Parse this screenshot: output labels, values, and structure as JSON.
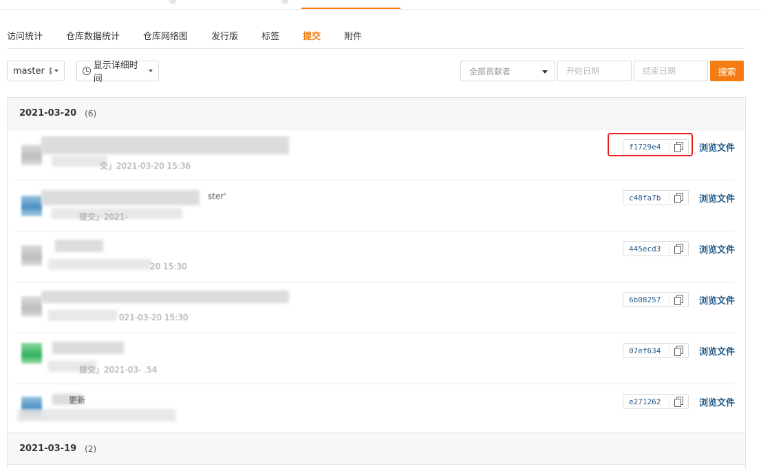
{
  "subnav": {
    "items": [
      {
        "label": "访问统计",
        "active": false
      },
      {
        "label": "仓库数据统计",
        "active": false
      },
      {
        "label": "仓库网络图",
        "active": false
      },
      {
        "label": "发行版",
        "active": false
      },
      {
        "label": "标签",
        "active": false
      },
      {
        "label": "提交",
        "active": true
      },
      {
        "label": "附件",
        "active": false
      }
    ]
  },
  "toolbar": {
    "branch_label": "master",
    "time_toggle_label": "显示详细时间",
    "author_select_label": "全部贡献者",
    "start_date_placeholder": "开始日期",
    "end_date_placeholder": "结束日期",
    "search_label": "搜索"
  },
  "groups": [
    {
      "date": "2021-03-20",
      "count": "(6)",
      "commits": [
        {
          "sha": "f1729e4",
          "browse": "浏览文件",
          "meta": "交」2021-03-20 15:36",
          "title_frag": "",
          "avatar": "gray"
        },
        {
          "sha": "c48fa7b",
          "browse": "浏览文件",
          "meta": "提交」2021-",
          "title_frag": "ster'",
          "avatar": "blue"
        },
        {
          "sha": "445ecd3",
          "browse": "浏览文件",
          "meta": "20 15:30",
          "title_frag": "",
          "avatar": "gray"
        },
        {
          "sha": "6b08257",
          "browse": "浏览文件",
          "meta": "021-03-20 15:30",
          "title_frag": "",
          "avatar": "gray"
        },
        {
          "sha": "07ef634",
          "browse": "浏览文件",
          "meta": "提交」2021-03-   .54",
          "title_frag": "",
          "avatar": "green"
        },
        {
          "sha": "e271262",
          "browse": "浏览文件",
          "meta": "",
          "title_frag": "更新",
          "avatar": "blue"
        }
      ]
    },
    {
      "date": "2021-03-19",
      "count": "(2)"
    }
  ],
  "colors": {
    "accent": "#f27c12",
    "link": "#1f5a8a",
    "highlight": "#e8201f"
  },
  "icons": {
    "branch_protect": "shield-icon",
    "time": "clock-icon",
    "copy": "copy-icon"
  }
}
